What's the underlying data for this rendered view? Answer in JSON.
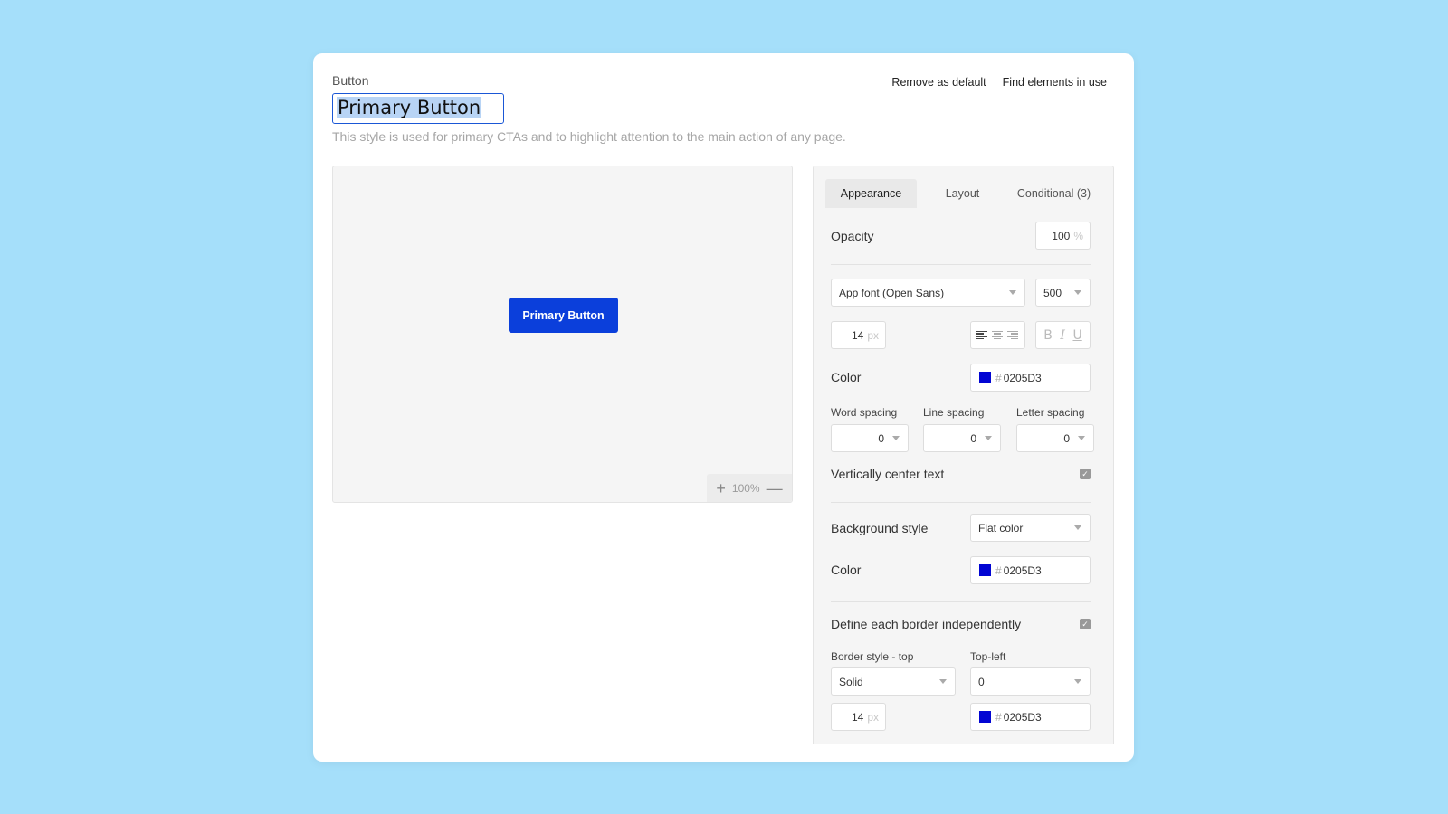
{
  "header": {
    "kind": "Button",
    "title": "Primary Button",
    "description": "This style is used for primary CTAs and to highlight attention to the main action of any page.",
    "actions": {
      "remove_default": "Remove as default",
      "find_elements": "Find elements in use"
    }
  },
  "preview": {
    "button_label": "Primary Button",
    "button_color": "#0b3fdb",
    "zoom": {
      "plus": "+",
      "value": "100%",
      "minus": "—"
    }
  },
  "panel": {
    "tabs": [
      {
        "label": "Appearance",
        "active": true
      },
      {
        "label": "Layout",
        "active": false
      },
      {
        "label": "Conditional (3)",
        "active": false
      }
    ],
    "opacity": {
      "label": "Opacity",
      "value": "100",
      "unit": "%"
    },
    "font": {
      "family": "App font (Open Sans)",
      "weight": "500",
      "size": "14",
      "size_unit": "px",
      "text_align": "left",
      "format_icons": [
        "B",
        "I",
        "U"
      ]
    },
    "text_color": {
      "label": "Color",
      "hash": "#",
      "value": "0205D3",
      "swatch": "#0205d3"
    },
    "spacing": {
      "word": {
        "label": "Word spacing",
        "value": "0"
      },
      "line": {
        "label": "Line spacing",
        "value": "0"
      },
      "letter": {
        "label": "Letter spacing",
        "value": "0"
      }
    },
    "vertically_center": {
      "label": "Vertically center text",
      "checked": true
    },
    "background": {
      "label": "Background style",
      "value": "Flat color"
    },
    "bg_color": {
      "label": "Color",
      "hash": "#",
      "value": "0205D3",
      "swatch": "#0205d3"
    },
    "borders_independent": {
      "label": "Define each border independently",
      "checked": true
    },
    "border_top": {
      "label": "Border style - top",
      "value": "Solid",
      "width": "14",
      "width_unit": "px",
      "hash": "#",
      "color": "0205D3",
      "swatch": "#0205d3"
    },
    "top_left": {
      "label": "Top-left",
      "value": "0"
    }
  }
}
